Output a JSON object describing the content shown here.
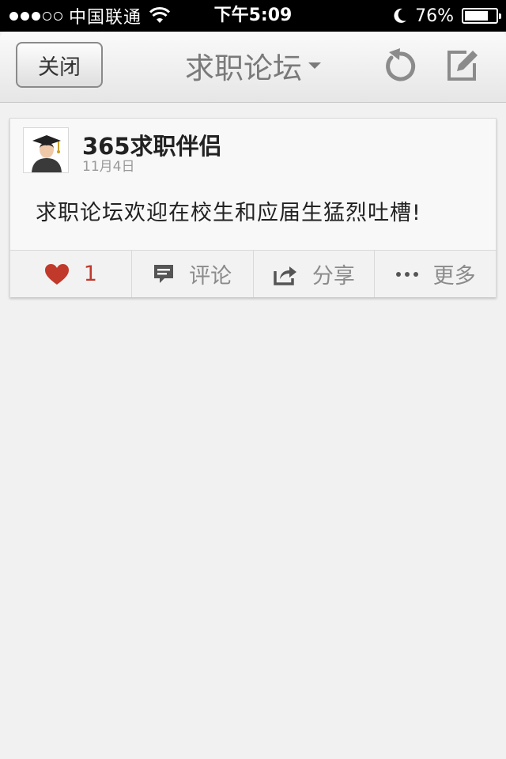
{
  "status_bar": {
    "carrier": "中国联通",
    "time": "下午5:09",
    "battery_text": "76%",
    "battery_level": 0.76,
    "signal_bars": 3,
    "signal_total": 5
  },
  "navbar": {
    "close_label": "关闭",
    "title": "求职论坛",
    "icons": [
      "refresh-icon",
      "compose-icon",
      "dropdown-caret-icon"
    ]
  },
  "post": {
    "author": "365求职伴侣",
    "date": "11月4日",
    "content": "求职论坛欢迎在校生和应届生猛烈吐槽!",
    "actions": {
      "like_count": "1",
      "comment_label": "评论",
      "share_label": "分享",
      "more_label": "更多"
    }
  },
  "colors": {
    "accent_like": "#c0392b",
    "nav_title": "#7a7a7a",
    "background": "#f1f1f1"
  }
}
